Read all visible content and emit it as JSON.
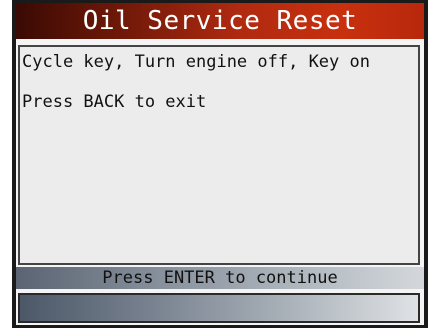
{
  "title": "Oil Service Reset",
  "content": {
    "line1": "Cycle key, Turn engine off, Key on",
    "line2": "Press BACK to exit"
  },
  "status": "Press ENTER to continue",
  "colors": {
    "title_bar_dark": "#3a0a04",
    "title_bar_bright": "#c8300e",
    "status_bar_dark": "#5a6472",
    "status_bar_light": "#d4d8dc",
    "content_background": "#ececec",
    "frame": "#1a1a1a"
  }
}
